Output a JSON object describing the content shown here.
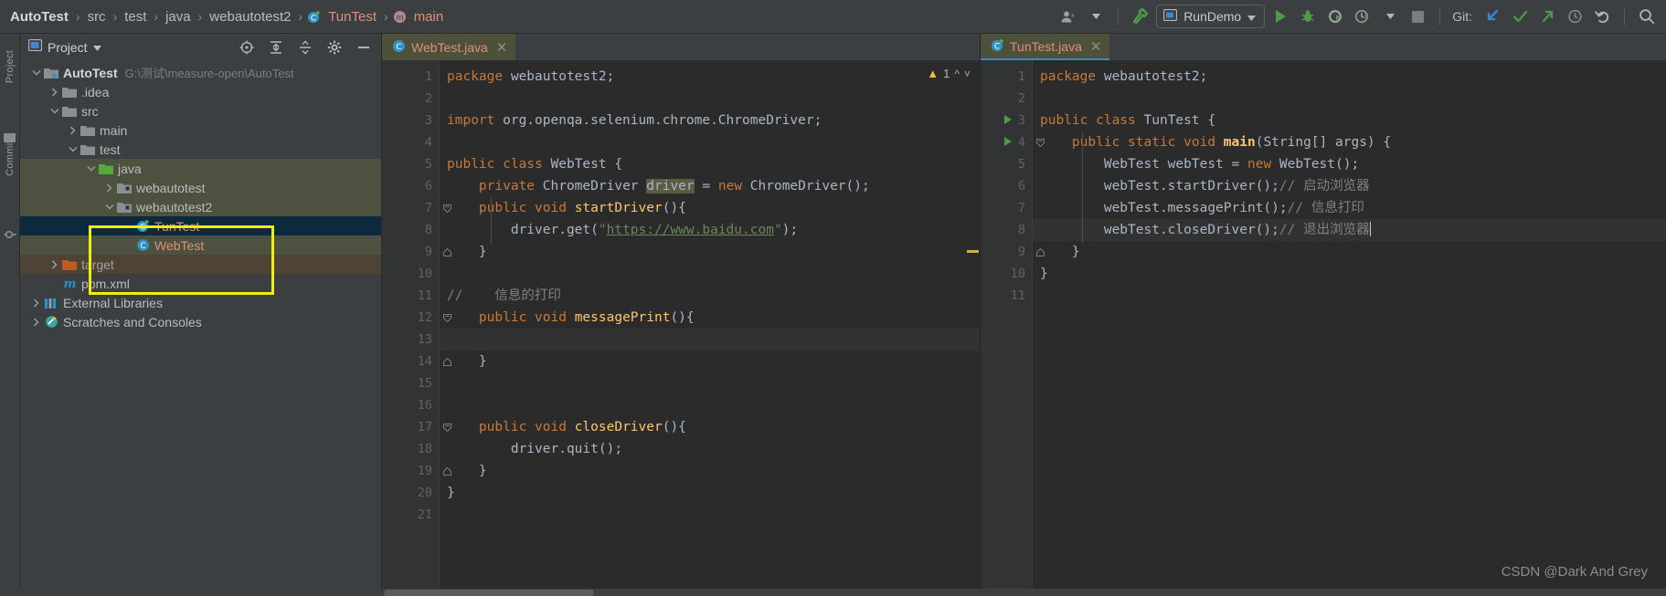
{
  "breadcrumb": {
    "items": [
      {
        "label": "AutoTest",
        "style": "bold"
      },
      {
        "label": "src",
        "style": "normal"
      },
      {
        "label": "test",
        "style": "normal"
      },
      {
        "label": "java",
        "style": "normal"
      },
      {
        "label": "webautotest2",
        "style": "normal"
      },
      {
        "label": "TunTest",
        "style": "red",
        "icon": "java-class-icon"
      },
      {
        "label": "main",
        "style": "red",
        "icon": "method-icon"
      }
    ],
    "separator": "›"
  },
  "toolbar": {
    "account_icon": "user-avatar-icon",
    "account_dropdown_icon": "chevron-down-icon",
    "build_icon": "build-hammer-icon",
    "run_config": {
      "label": "RunDemo",
      "icon": "run-configuration-icon",
      "dropdown_icon": "chevron-down-icon"
    },
    "run_icon": "run-play-icon",
    "debug_icon": "debug-bug-icon",
    "run_coverage_icon": "run-with-coverage-icon",
    "profiler_icon": "profiler-clock-icon",
    "profiler_dropdown_icon": "chevron-down-icon",
    "stop_icon": "stop-square-icon",
    "git_label": "Git:",
    "git_update_icon": "git-update-arrow-icon",
    "git_commit_icon": "git-commit-check-icon",
    "git_push_icon": "git-push-arrow-icon",
    "git_history_icon": "git-history-clock-icon",
    "git_rollback_icon": "git-rollback-icon",
    "search_icon": "search-magnifier-icon"
  },
  "tool_strip": {
    "project_label": "Project",
    "commit_label": "Commit",
    "structure_icon": "structure-icon",
    "commit_icon": "commit-icon"
  },
  "project_panel": {
    "title": "Project",
    "title_icon": "project-view-icon",
    "title_dropdown_icon": "chevron-down-icon",
    "actions": [
      {
        "icon": "select-opened-file-icon"
      },
      {
        "icon": "expand-all-icon"
      },
      {
        "icon": "collapse-all-icon"
      },
      {
        "icon": "settings-gear-icon"
      },
      {
        "icon": "hide-panel-minus-icon"
      }
    ],
    "tree": [
      {
        "label": "AutoTest",
        "path": "G:\\测试\\measure-open\\AutoTest",
        "indent": 0,
        "arrow": "down",
        "icon": "module-folder-icon",
        "bold": true,
        "row": "normal"
      },
      {
        "label": ".idea",
        "indent": 1,
        "arrow": "right",
        "icon": "folder-icon",
        "row": "normal"
      },
      {
        "label": "src",
        "indent": 1,
        "arrow": "down",
        "icon": "folder-icon",
        "row": "normal"
      },
      {
        "label": "main",
        "indent": 2,
        "arrow": "right",
        "icon": "folder-icon",
        "row": "normal"
      },
      {
        "label": "test",
        "indent": 2,
        "arrow": "down",
        "icon": "folder-icon",
        "row": "normal"
      },
      {
        "label": "java",
        "indent": 3,
        "arrow": "down",
        "icon": "source-root-folder-icon",
        "row": "green"
      },
      {
        "label": "webautotest",
        "indent": 4,
        "arrow": "right",
        "icon": "package-icon",
        "row": "green"
      },
      {
        "label": "webautotest2",
        "indent": 4,
        "arrow": "down",
        "icon": "package-icon",
        "row": "green"
      },
      {
        "label": "TunTest",
        "indent": 5,
        "arrow": "none",
        "icon": "java-runnable-class-icon",
        "row": "selected",
        "kind": "class"
      },
      {
        "label": "WebTest",
        "indent": 5,
        "arrow": "none",
        "icon": "java-class-icon",
        "row": "green",
        "kind": "class"
      },
      {
        "label": "target",
        "indent": 1,
        "arrow": "right",
        "icon": "excluded-folder-icon",
        "row": "brown",
        "dim": true
      },
      {
        "label": "pom.xml",
        "indent": 1,
        "arrow": "none",
        "icon": "maven-xml-icon",
        "row": "normal"
      },
      {
        "label": "External Libraries",
        "indent": 0,
        "arrow": "right",
        "icon": "external-libraries-icon",
        "row": "normal"
      },
      {
        "label": "Scratches and Consoles",
        "indent": 0,
        "arrow": "right",
        "icon": "scratches-icon",
        "row": "normal"
      }
    ],
    "highlight_note": "yellow-annotation-box"
  },
  "editor_left": {
    "tab": {
      "label": "WebTest.java",
      "icon": "java-class-icon",
      "close_icon": "close-x-icon"
    },
    "inspections": {
      "count": "1",
      "warn_icon": "warning-triangle-icon",
      "prev_icon": "chevron-up-icon",
      "next_icon": "chevron-down-icon"
    },
    "lines": [
      {
        "n": "1",
        "tokens": [
          {
            "t": "package ",
            "c": "kw"
          },
          {
            "t": "webautotest2;",
            "c": "id"
          }
        ]
      },
      {
        "n": "2",
        "tokens": []
      },
      {
        "n": "3",
        "tokens": [
          {
            "t": "import ",
            "c": "kw"
          },
          {
            "t": "org.openqa.selenium.chrome.ChromeDriver;",
            "c": "id"
          }
        ]
      },
      {
        "n": "4",
        "tokens": []
      },
      {
        "n": "5",
        "tokens": [
          {
            "t": "public class ",
            "c": "kw"
          },
          {
            "t": "WebTest ",
            "c": "id"
          },
          {
            "t": "{",
            "c": "id"
          }
        ]
      },
      {
        "n": "6",
        "tokens": [
          {
            "t": "    private ",
            "c": "kw"
          },
          {
            "t": "ChromeDriver ",
            "c": "id"
          },
          {
            "t": "driver",
            "c": "hlw"
          },
          {
            "t": " = ",
            "c": "id"
          },
          {
            "t": "new ",
            "c": "kw"
          },
          {
            "t": "ChromeDriver();",
            "c": "id"
          }
        ]
      },
      {
        "n": "7",
        "tokens": [
          {
            "t": "    ",
            "c": "id"
          },
          {
            "t": "public void ",
            "c": "kw"
          },
          {
            "t": "startDriver",
            "c": "fn"
          },
          {
            "t": "(){",
            "c": "id"
          }
        ],
        "fold": "minus"
      },
      {
        "n": "8",
        "tokens": [
          {
            "t": "        driver.get(",
            "c": "id"
          },
          {
            "t": "\"",
            "c": "str"
          },
          {
            "t": "https://www.baidu.com",
            "c": "lnk"
          },
          {
            "t": "\"",
            "c": "str"
          },
          {
            "t": ");",
            "c": "id"
          }
        ]
      },
      {
        "n": "9",
        "tokens": [
          {
            "t": "    }",
            "c": "id"
          }
        ],
        "fold": "end"
      },
      {
        "n": "10",
        "tokens": []
      },
      {
        "n": "11",
        "tokens": [
          {
            "t": "//    信息的打印",
            "c": "cmt"
          }
        ]
      },
      {
        "n": "12",
        "tokens": [
          {
            "t": "    ",
            "c": "id"
          },
          {
            "t": "public void ",
            "c": "kw"
          },
          {
            "t": "messagePrint",
            "c": "fn"
          },
          {
            "t": "(){",
            "c": "id"
          }
        ],
        "fold": "minus"
      },
      {
        "n": "13",
        "tokens": [],
        "highlight": true
      },
      {
        "n": "14",
        "tokens": [
          {
            "t": "    }",
            "c": "id"
          }
        ],
        "fold": "end"
      },
      {
        "n": "15",
        "tokens": []
      },
      {
        "n": "16",
        "tokens": []
      },
      {
        "n": "17",
        "tokens": [
          {
            "t": "    ",
            "c": "id"
          },
          {
            "t": "public void ",
            "c": "kw"
          },
          {
            "t": "closeDriver",
            "c": "fn"
          },
          {
            "t": "(){",
            "c": "id"
          }
        ],
        "fold": "minus"
      },
      {
        "n": "18",
        "tokens": [
          {
            "t": "        driver.quit();",
            "c": "id"
          }
        ]
      },
      {
        "n": "19",
        "tokens": [
          {
            "t": "    }",
            "c": "id"
          }
        ],
        "fold": "end"
      },
      {
        "n": "20",
        "tokens": [
          {
            "t": "}",
            "c": "id"
          }
        ]
      },
      {
        "n": "21",
        "tokens": []
      }
    ]
  },
  "editor_right": {
    "tab": {
      "label": "TunTest.java",
      "icon": "java-runnable-class-icon",
      "close_icon": "close-x-icon"
    },
    "lines": [
      {
        "n": "1",
        "tokens": [
          {
            "t": "package ",
            "c": "kw"
          },
          {
            "t": "webautotest2;",
            "c": "id"
          }
        ]
      },
      {
        "n": "2",
        "tokens": []
      },
      {
        "n": "3",
        "tokens": [
          {
            "t": "public class ",
            "c": "kw"
          },
          {
            "t": "TunTest ",
            "c": "id"
          },
          {
            "t": "{",
            "c": "id"
          }
        ],
        "run": true
      },
      {
        "n": "4",
        "tokens": [
          {
            "t": "    ",
            "c": "id"
          },
          {
            "t": "public static void ",
            "c": "kw"
          },
          {
            "t": "main",
            "c": "fnb"
          },
          {
            "t": "(String[] args) {",
            "c": "id"
          }
        ],
        "run": true,
        "fold": "minus"
      },
      {
        "n": "5",
        "tokens": [
          {
            "t": "        WebTest webTest = ",
            "c": "id"
          },
          {
            "t": "new ",
            "c": "kw"
          },
          {
            "t": "WebTest();",
            "c": "id"
          }
        ]
      },
      {
        "n": "6",
        "tokens": [
          {
            "t": "        webTest.startDriver();",
            "c": "id"
          },
          {
            "t": "// 启动浏览器",
            "c": "cmt"
          }
        ]
      },
      {
        "n": "7",
        "tokens": [
          {
            "t": "        webTest.messagePrint();",
            "c": "id"
          },
          {
            "t": "// 信息打印",
            "c": "cmt"
          }
        ]
      },
      {
        "n": "8",
        "tokens": [
          {
            "t": "        webTest.closeDriver();",
            "c": "id"
          },
          {
            "t": "// 退出浏览器",
            "c": "cmt"
          }
        ],
        "caret": true,
        "highlight": true
      },
      {
        "n": "9",
        "tokens": [
          {
            "t": "    }",
            "c": "id"
          }
        ],
        "fold": "end"
      },
      {
        "n": "10",
        "tokens": [
          {
            "t": "}",
            "c": "id"
          }
        ]
      },
      {
        "n": "11",
        "tokens": []
      }
    ]
  },
  "watermark": "CSDN @Dark And Grey",
  "colors": {
    "accent_blue": "#3e86d0",
    "highlight_yellow": "#f2ee0a",
    "selection_blue": "#0d293e",
    "source_green": "#4d5240",
    "excluded_brown": "#4e4435",
    "class_red": "#e08e79",
    "keyword_orange": "#cc7832",
    "string_green": "#6a8759",
    "method_yellow": "#ffc66d",
    "run_green": "#4f9a45"
  }
}
